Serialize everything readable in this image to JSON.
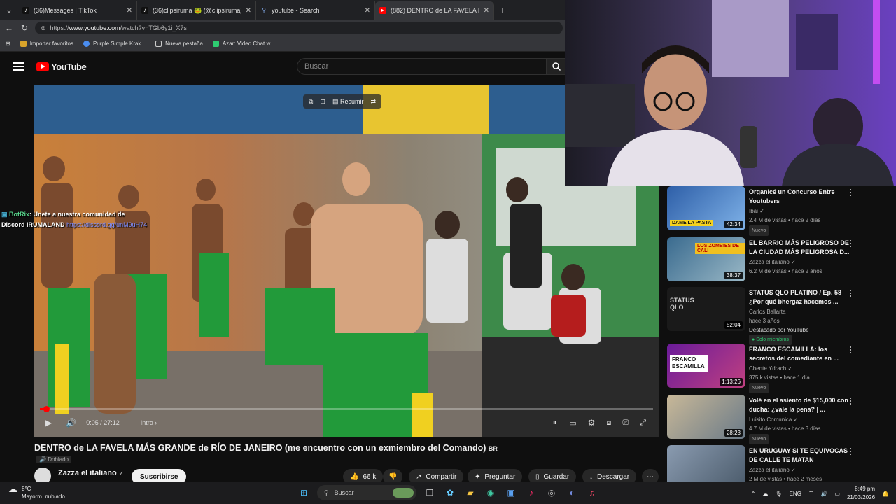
{
  "tabs": [
    {
      "label": "(36)Messages | TikTok",
      "icon": "tiktok-icon"
    },
    {
      "label": "(36)clipsiruma 🐸 (@clipsiruma) |",
      "icon": "tiktok-icon"
    },
    {
      "label": "youtube - Search",
      "icon": "search-icon"
    },
    {
      "label": "(882) DENTRO de LA FAVELA MÁS",
      "icon": "youtube-icon"
    }
  ],
  "address": {
    "url_prefix": "https://",
    "url_host": "www.youtube.com",
    "url_rest": "/watch?v=TGb6y1i_X7s"
  },
  "bookmarks": [
    "Importar favoritos",
    "Purple Simple Krak...",
    "Nueva pestaña",
    "Azar: Video Chat w..."
  ],
  "youtube": {
    "logo": "YouTube",
    "search_placeholder": "Buscar"
  },
  "player": {
    "tools": {
      "summary": "Resumir"
    },
    "time": "0:05 / 27:12",
    "chapter": "Intro",
    "progress": 0.003
  },
  "chat": {
    "user": "BotRix",
    "message": ": Unete a nuestra comunidad de",
    "line2": "Discord IRUMALAND",
    "link": "https://discord.gg/unM9uH74"
  },
  "video": {
    "title": "DENTRO de LA FAVELA MÁS GRANDE de RÍO DE JANEIRO (me encuentro con un exmiembro del Comando)",
    "flag": "BR",
    "dub": "Doblado",
    "channel": "Zazza el italiano",
    "subscribe": "Suscribirse",
    "likes": "66 k",
    "share": "Compartir",
    "ask": "Preguntar",
    "save": "Guardar",
    "download": "Descargar"
  },
  "recs": [
    {
      "title": "Organicé un Concurso Entre Youtubers",
      "channel": "Ibai",
      "meta": "2.4 M de vistas • hace 2 días",
      "duration": "42:34",
      "badge": "Nuevo",
      "thumb_text": "DAME LA PASTA"
    },
    {
      "title": "EL BARRIO MÁS PELIGROSO DE LA CIUDAD MÁS PELIGROSA D...",
      "channel": "Zazza el italiano",
      "meta": "6.2 M de vistas • hace 2 años",
      "duration": "38:37",
      "badge": "",
      "thumb_text": "LOS ZOMBIES DE CALI"
    },
    {
      "title": "STATUS QLO PLATINO / Ep. 58 ¿Por qué bhergaz hacemos ...",
      "channel": "Carlos Ballarta",
      "meta": "hace 3 años",
      "extra": "Destacado por YouTube",
      "duration": "52:04",
      "badge": "Solo miembros",
      "thumb_text": "STATUS QLO"
    },
    {
      "title": "FRANCO ESCAMILLA: los secretos del comediante en ...",
      "channel": "Chente Ydrach",
      "meta": "375 k vistas • hace 1 día",
      "duration": "1:13:26",
      "badge": "Nuevo",
      "thumb_text": "FRANCO ESCAMILLA"
    },
    {
      "title": "Volé en el asiento de $15,000 con ducha: ¿vale la pena? | ...",
      "channel": "Luisito Comunica",
      "meta": "4.7 M de vistas • hace 3 días",
      "duration": "28:23",
      "badge": "Nuevo",
      "thumb_text": ""
    },
    {
      "title": "EN URUGUAY SI TE EQUIVOCAS DE CALLE TE MATAN",
      "channel": "Zazza el italiano",
      "meta": "2 M de vistas • hace 2 meses",
      "duration": "",
      "badge": "",
      "thumb_text": ""
    }
  ],
  "taskbar": {
    "temp": "8°C",
    "weather": "Mayorm. nublado",
    "search": "Buscar",
    "lang": "ENG",
    "time": "8:49 pm",
    "date": "21/03/2026"
  }
}
